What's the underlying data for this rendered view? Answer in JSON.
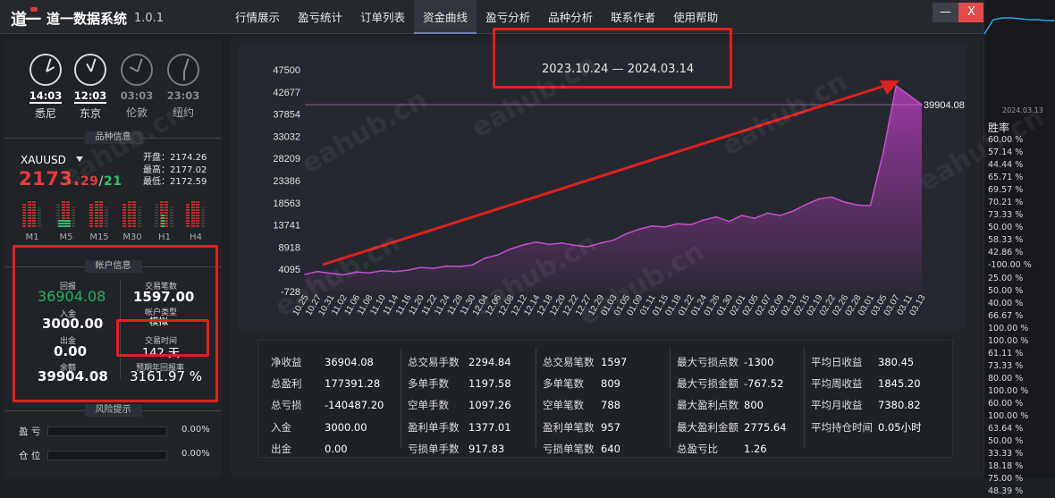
{
  "app": {
    "title": "道一数据系统",
    "version": "1.0.1"
  },
  "menu": [
    "行情展示",
    "盈亏统计",
    "订单列表",
    "资金曲线",
    "盈亏分析",
    "品种分析",
    "联系作者",
    "使用帮助"
  ],
  "active_menu": "资金曲线",
  "window": {
    "minimize": "—",
    "close": "X"
  },
  "clocks": [
    {
      "time": "14:03",
      "city": "悉尼",
      "active": true
    },
    {
      "time": "12:03",
      "city": "东京",
      "active": true
    },
    {
      "time": "03:03",
      "city": "伦敦",
      "active": false
    },
    {
      "time": "23:03",
      "city": "纽约",
      "active": false
    }
  ],
  "instrument": {
    "section": "品种信息",
    "symbol": "XAUUSD",
    "price_main": "2173.",
    "price_fraction": "29",
    "price_sep": "/",
    "price_alt": "21",
    "ohl": [
      {
        "label": "开盘",
        "value": "2174.26"
      },
      {
        "label": "最高",
        "value": "2177.02"
      },
      {
        "label": "最低",
        "value": "2172.59"
      }
    ],
    "timeframes": [
      "M1",
      "M5",
      "M15",
      "M30",
      "H1",
      "H4"
    ]
  },
  "account": {
    "section": "帐户信息",
    "profit_label": "回报",
    "profit_value": "36904.08",
    "trade_count_label": "交易笔数",
    "trade_count_value": "1597.00",
    "deposit_label": "入金",
    "deposit_value": "3000.00",
    "account_type_label": "帐户类型",
    "account_type_value": "模拟",
    "withdraw_label": "出金",
    "withdraw_value": "0.00",
    "trade_time_label": "交易时间",
    "trade_time_value": "142 天",
    "balance_label": "余额",
    "balance_value": "39904.08",
    "annual_label": "预期年回报率",
    "annual_value": "3161.97 %"
  },
  "risk": {
    "section": "风险提示",
    "items": [
      {
        "label": "盈 亏",
        "value": "0.00%",
        "fraction": 0
      },
      {
        "label": "仓 位",
        "value": "0.00%",
        "fraction": 0
      }
    ]
  },
  "chart_data": {
    "type": "area",
    "title": "2023.10.24 — 2024.03.14",
    "x": [
      "10.25",
      "10.27",
      "10.31",
      "11.02",
      "11.06",
      "11.08",
      "11.10",
      "11.14",
      "11.16",
      "11.20",
      "11.22",
      "11.24",
      "11.28",
      "11.30",
      "12.04",
      "12.06",
      "12.08",
      "12.12",
      "12.14",
      "12.18",
      "12.20",
      "12.22",
      "12.27",
      "12.29",
      "01.03",
      "01.05",
      "01.09",
      "01.11",
      "01.15",
      "01.18",
      "01.22",
      "01.24",
      "01.26",
      "01.30",
      "02.01",
      "02.05",
      "02.07",
      "02.09",
      "02.13",
      "02.15",
      "02.19",
      "02.22",
      "02.26",
      "02.28",
      "03.01",
      "03.05",
      "03.07",
      "03.11",
      "03.13"
    ],
    "y": [
      3000,
      3600,
      3200,
      2900,
      3500,
      3300,
      3800,
      3600,
      3900,
      4500,
      4300,
      4800,
      4700,
      5000,
      6500,
      7200,
      8500,
      9400,
      10000,
      9500,
      9800,
      9300,
      9000,
      9800,
      10400,
      11800,
      12800,
      13500,
      13300,
      14000,
      13800,
      14800,
      15500,
      14500,
      15800,
      15200,
      16300,
      15800,
      16800,
      18200,
      19400,
      19800,
      18700,
      18100,
      17900,
      29500,
      44000,
      42000,
      39904.08
    ],
    "yticks": [
      "47500",
      "42677",
      "37854",
      "33032",
      "28209",
      "23386",
      "18563",
      "13741",
      "8918",
      "4095",
      "-728"
    ],
    "ylim": [
      -728,
      47500
    ],
    "last_label": "39904.08",
    "color": "#b13bb8"
  },
  "stats": {
    "col1": [
      {
        "k": "净收益",
        "v": "36904.08"
      },
      {
        "k": "总盈利",
        "v": "177391.28"
      },
      {
        "k": "总亏损",
        "v": "-140487.20"
      },
      {
        "k": "入金",
        "v": "3000.00"
      },
      {
        "k": "出金",
        "v": "0.00"
      }
    ],
    "col2": [
      {
        "k": "总交易手数",
        "v": "2294.84"
      },
      {
        "k": "多单手数",
        "v": "1197.58"
      },
      {
        "k": "空单手数",
        "v": "1097.26"
      },
      {
        "k": "盈利单手数",
        "v": "1377.01"
      },
      {
        "k": "亏损单手数",
        "v": "917.83"
      }
    ],
    "col3": [
      {
        "k": "总交易笔数",
        "v": "1597"
      },
      {
        "k": "多单笔数",
        "v": "809"
      },
      {
        "k": "空单笔数",
        "v": "788"
      },
      {
        "k": "盈利单笔数",
        "v": "957"
      },
      {
        "k": "亏损单笔数",
        "v": "640"
      }
    ],
    "col4": [
      {
        "k": "最大亏损点数",
        "v": "-1300"
      },
      {
        "k": "最大亏损金额",
        "v": "-767.52"
      },
      {
        "k": "最大盈利点数",
        "v": "800"
      },
      {
        "k": "最大盈利金额",
        "v": "2775.64"
      },
      {
        "k": "总盈亏比",
        "v": "1.26"
      }
    ],
    "col5": [
      {
        "k": "平均日收益",
        "v": "380.45"
      },
      {
        "k": "平均周收益",
        "v": "1845.20"
      },
      {
        "k": "平均月收益",
        "v": "7380.82"
      },
      {
        "k": "平均持仓时间",
        "v": "0.05小时"
      }
    ]
  },
  "right_strip": {
    "date": "2024.03.13",
    "title": "胜率",
    "values": [
      "60.00 %",
      "57.14 %",
      "44.44 %",
      "65.71 %",
      "69.57 %",
      "70.21 %",
      "73.33 %",
      "50.00 %",
      "58.33 %",
      "42.86 %",
      "-100.00 %",
      "25.00 %",
      "50.00 %",
      "40.00 %",
      "66.67 %",
      "100.00 %",
      "100.00 %",
      "61.11 %",
      "73.33 %",
      "80.00 %",
      "100.00 %",
      "60.00 %",
      "100.00 %",
      "63.64 %",
      "50.00 %",
      "33.33 %",
      "18.18 %",
      "75.00 %",
      "48.39 %"
    ]
  },
  "watermark": "eahub.cn"
}
